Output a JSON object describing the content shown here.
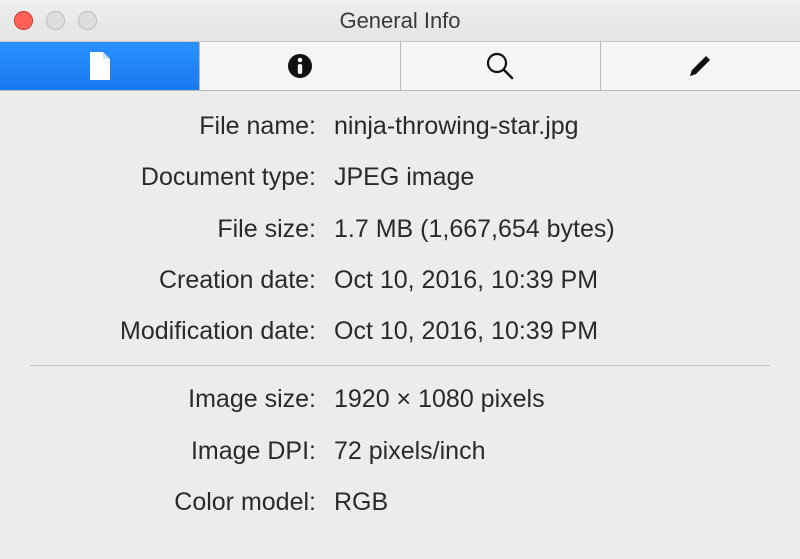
{
  "window": {
    "title": "General Info"
  },
  "tabs": {
    "file_icon": "file-icon",
    "info_icon": "info-icon",
    "search_icon": "search-icon",
    "edit_icon": "pencil-icon"
  },
  "labels": {
    "file_name": "File name:",
    "document_type": "Document type:",
    "file_size": "File size:",
    "creation_date": "Creation date:",
    "modification_date": "Modification date:",
    "image_size": "Image size:",
    "image_dpi": "Image DPI:",
    "color_model": "Color model:"
  },
  "values": {
    "file_name": "ninja-throwing-star.jpg",
    "document_type": "JPEG image",
    "file_size": "1.7 MB (1,667,654 bytes)",
    "creation_date": "Oct 10, 2016, 10:39 PM",
    "modification_date": "Oct 10, 2016, 10:39 PM",
    "image_size": "1920 × 1080 pixels",
    "image_dpi": "72 pixels/inch",
    "color_model": "RGB"
  }
}
